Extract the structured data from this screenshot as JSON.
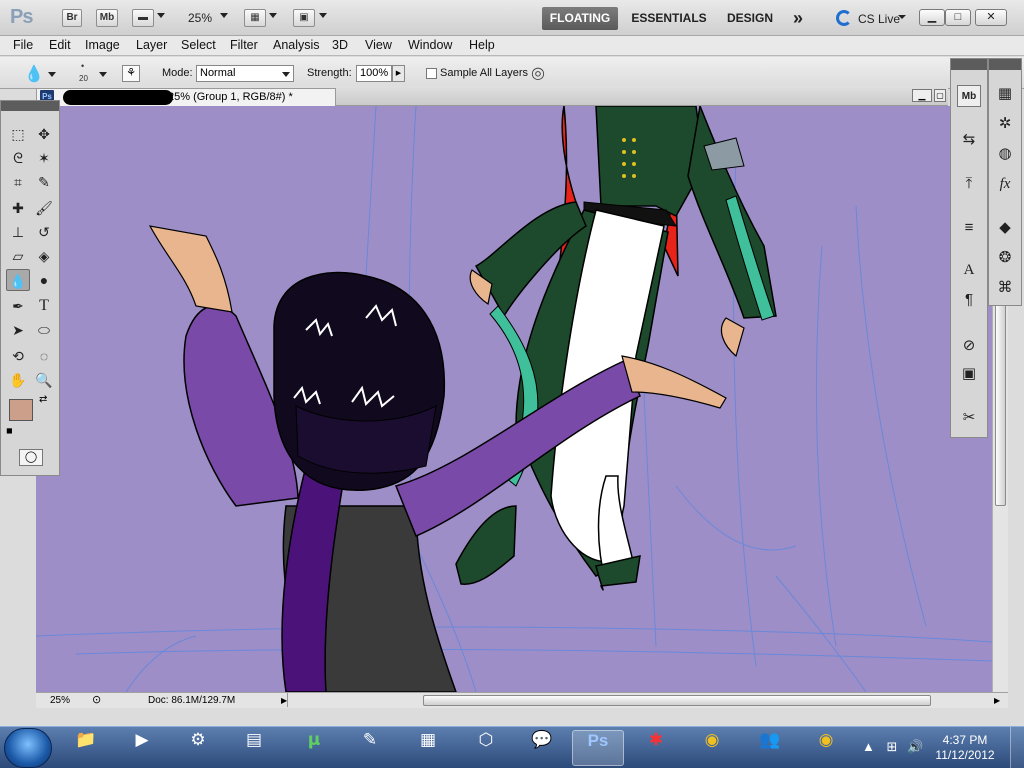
{
  "appbar": {
    "logo": "Ps",
    "bridge": "Br",
    "minibridge": "Mb",
    "zoom": "25%",
    "workspaces": [
      "FLOATING",
      "ESSENTIALS",
      "DESIGN"
    ],
    "more": "»",
    "cs_live": "CS Live",
    "win_min": "▭",
    "win_max": "□",
    "win_close": "✕"
  },
  "menu": [
    "File",
    "Edit",
    "Image",
    "Layer",
    "Select",
    "Filter",
    "Analysis",
    "3D",
    "View",
    "Window",
    "Help"
  ],
  "options": {
    "brush_size": "20",
    "mode_label": "Mode:",
    "mode_value": "Normal",
    "strength_label": "Strength:",
    "strength_value": "100%",
    "sample_all_layers": "Sample All Layers"
  },
  "document": {
    "tab_title": "psd @ 25% (Group 1, RGB/8#) *",
    "ps_icon": "Ps"
  },
  "status": {
    "zoom": "25%",
    "doc_size": "Doc: 86.1M/129.7M"
  },
  "taskbar": {
    "time": "4:37 PM",
    "date": "11/12/2012",
    "items": [
      "📁",
      "▶",
      "⚙",
      "▤",
      "µ",
      "✎",
      "▦",
      "⬡",
      "💬",
      "Ps",
      "✱",
      "◉",
      "👥",
      "◉"
    ]
  },
  "colors": {
    "canvas_bg": "#9d8ec7",
    "foreground": "#cc9f8a",
    "background": "#ffffff"
  }
}
